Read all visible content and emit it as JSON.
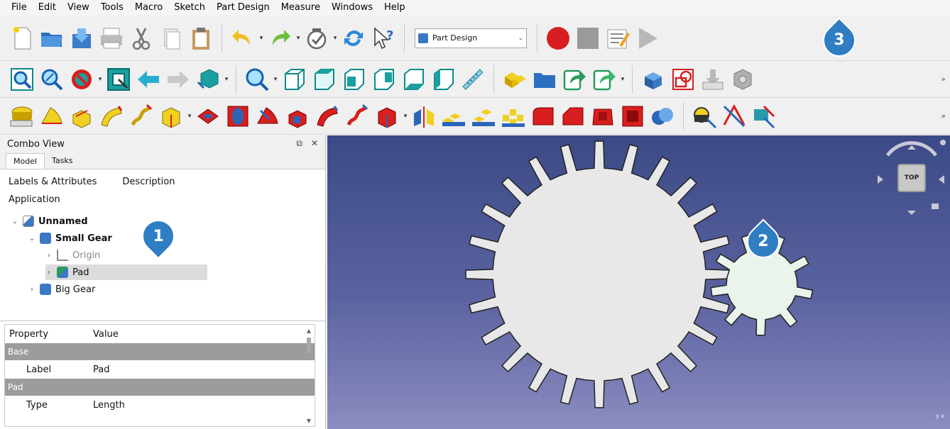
{
  "menu": [
    "File",
    "Edit",
    "View",
    "Tools",
    "Macro",
    "Sketch",
    "Part Design",
    "Measure",
    "Windows",
    "Help"
  ],
  "workbench_select": {
    "value": "Part Design"
  },
  "combo": {
    "title": "Combo View",
    "tabs": [
      "Model",
      "Tasks"
    ],
    "columns": [
      "Labels & Attributes",
      "Description"
    ],
    "application_label": "Application",
    "tree": [
      {
        "label": "Unnamed",
        "level": 0,
        "expanded": true,
        "bold": true,
        "icon": "document-icon"
      },
      {
        "label": "Small Gear",
        "level": 1,
        "expanded": true,
        "bold": true,
        "icon": "body-icon"
      },
      {
        "label": "Origin",
        "level": 2,
        "expanded": false,
        "bold": false,
        "grey": true,
        "icon": "origin-icon"
      },
      {
        "label": "Pad",
        "level": 2,
        "expanded": false,
        "bold": false,
        "selected": true,
        "icon": "pad-icon"
      },
      {
        "label": "Big Gear",
        "level": 1,
        "expanded": false,
        "bold": false,
        "icon": "body-icon"
      }
    ]
  },
  "properties": {
    "header": [
      "Property",
      "Value"
    ],
    "groups": [
      {
        "name": "Base",
        "rows": [
          {
            "prop": "Label",
            "value": "Pad"
          }
        ]
      },
      {
        "name": "Pad",
        "rows": [
          {
            "prop": "Type",
            "value": "Length"
          }
        ]
      }
    ]
  },
  "viewport": {
    "navcube_face": "TOP",
    "axis_label": "y x"
  },
  "callouts": {
    "one": "1",
    "two": "2",
    "three": "3"
  },
  "colors": {
    "callout": "#2f7dc2",
    "gear_big": "#e8e8e8",
    "gear_small": "#eaf4ea",
    "viewport_top": "#3b4a86"
  }
}
